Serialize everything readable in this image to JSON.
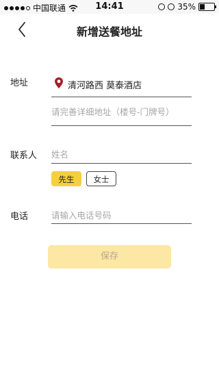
{
  "status_bar": {
    "carrier": "中国联通",
    "time": "14:41",
    "battery_percent": "35%",
    "battery_level": 0.35
  },
  "nav": {
    "title": "新增送餐地址"
  },
  "form": {
    "address_label": "地址",
    "address_value": "清河路西 莫泰酒店",
    "address_detail_placeholder": "请完善详细地址（楼号-门牌号）",
    "contact_label": "联系人",
    "name_placeholder": "姓名",
    "gender_options": [
      "先生",
      "女士"
    ],
    "gender_selected": "先生",
    "phone_label": "电话",
    "phone_placeholder": "请输入电话号码"
  },
  "save_label": "保存",
  "colors": {
    "accent": "#f5cf3c",
    "save_disabled_bg": "#fce7a4",
    "pin": "#a6202a",
    "placeholder": "#a7a7a7"
  },
  "icons": {
    "back": "chevron-left-icon",
    "location": "map-pin-icon"
  }
}
